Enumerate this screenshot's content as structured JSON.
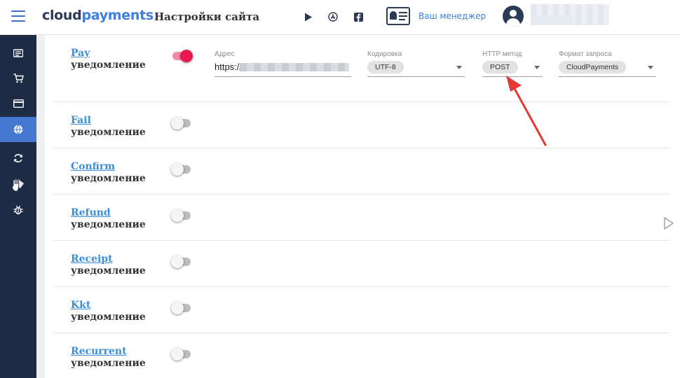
{
  "header": {
    "logo_part1": "cloud",
    "logo_part2": "payments",
    "page_title": "Настройки сайта",
    "manager_label": "Ваш менеджер"
  },
  "sidebar": {
    "active_index": 3
  },
  "notifications": [
    {
      "name": "Pay",
      "sub": "уведомление",
      "enabled": true
    },
    {
      "name": "Fail",
      "sub": "уведомление",
      "enabled": false
    },
    {
      "name": "Confirm",
      "sub": "уведомление",
      "enabled": false
    },
    {
      "name": "Refund",
      "sub": "уведомление",
      "enabled": false
    },
    {
      "name": "Receipt",
      "sub": "уведомление",
      "enabled": false
    },
    {
      "name": "Kkt",
      "sub": "уведомление",
      "enabled": false
    },
    {
      "name": "Recurrent",
      "sub": "уведомление",
      "enabled": false
    }
  ],
  "pay_settings": {
    "address_label": "Адрес",
    "address_value": "https://r",
    "encoding_label": "Кодировка",
    "encoding_value": "UTF-8",
    "method_label": "HTTP метод",
    "method_value": "POST",
    "format_label": "Формат запроса",
    "format_value": "CloudPayments"
  },
  "colors": {
    "accent": "#4478d1",
    "toggle_on": "#e8194f",
    "link": "#3b8ed6",
    "sidebar_bg": "#1e2b44"
  }
}
